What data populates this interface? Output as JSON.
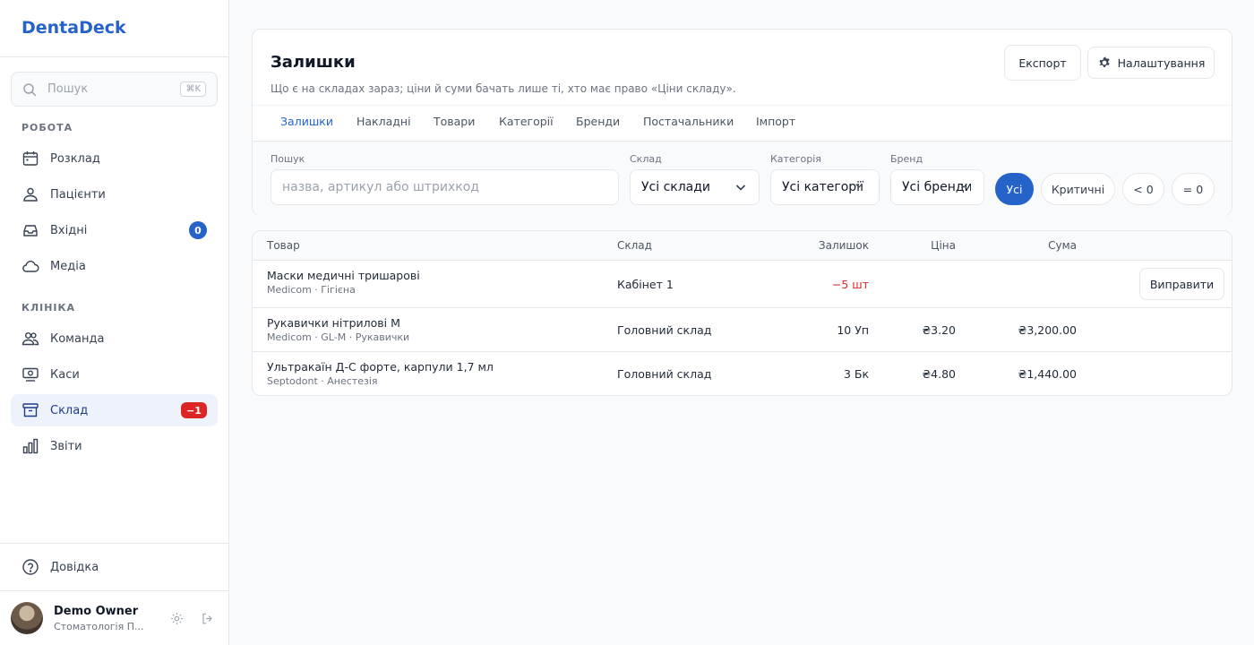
{
  "app": {
    "brand": "DentaDeck"
  },
  "sidebar": {
    "search_placeholder": "Пошук",
    "search_shortcut": "⌘K",
    "sections": [
      {
        "label": "РОБОТА"
      },
      {
        "label": "КЛІНІКА"
      }
    ],
    "items": [
      {
        "label": "Розклад",
        "icon": "calendar-icon"
      },
      {
        "label": "Пацієнти",
        "icon": "users-icon"
      },
      {
        "label": "Вхідні",
        "icon": "inbox-icon",
        "badge": "0"
      },
      {
        "label": "Медіа",
        "icon": "cloud-icon"
      },
      {
        "label": "Команда",
        "icon": "team-icon"
      },
      {
        "label": "Каси",
        "icon": "cash-icon"
      },
      {
        "label": "Склад",
        "icon": "archive-icon",
        "badge": "−1"
      },
      {
        "label": "Звіти",
        "icon": "bar-chart-icon"
      }
    ],
    "help_label": "Довідка",
    "user": {
      "name": "Demo Owner",
      "org": "Стоматологія П..."
    }
  },
  "page": {
    "title": "Залишки",
    "subtitle": "Що є на складах зараз; ціни й суми бачать лише ті, хто має право «Ціни складу».",
    "export_label": "Експорт",
    "settings_label": "Налаштування",
    "tabs": [
      "Залишки",
      "Накладні",
      "Товари",
      "Категорії",
      "Бренди",
      "Постачальники",
      "Імпорт"
    ]
  },
  "filters": {
    "search_label": "Пошук",
    "search_placeholder": "назва, артикул або штрихкод",
    "warehouse_label": "Склад",
    "warehouse_value": "Усі склади",
    "category_label": "Категорія",
    "category_value": "Усі категорії",
    "brand_label": "Бренд",
    "brand_value": "Усі бренди",
    "pills": [
      "Усі",
      "Критичні",
      "< 0",
      "= 0"
    ]
  },
  "table": {
    "columns": [
      "Товар",
      "Склад",
      "Залишок",
      "Ціна",
      "Сума"
    ],
    "fix_label": "Виправити",
    "rows": [
      {
        "name": "Маски медичні тришарові",
        "meta": "Medicom · Гігієна",
        "warehouse": "Кабінет 1",
        "stock": "−5 шт",
        "price": "",
        "sum": ""
      },
      {
        "name": "Рукавички нітрилові M",
        "meta": "Medicom · GL-M · Рукавички",
        "warehouse": "Головний склад",
        "stock": "10 Уп",
        "price": "₴3.20",
        "sum": "₴3,200.00"
      },
      {
        "name": "Ультракаїн Д-С форте, карпули 1,7 мл",
        "meta": "Septodont · Анестезія",
        "warehouse": "Головний склад",
        "stock": "3 Бк",
        "price": "₴4.80",
        "sum": "₴1,440.00"
      }
    ]
  },
  "colors": {
    "accent": "#2563c9",
    "danger": "#dc2626"
  }
}
